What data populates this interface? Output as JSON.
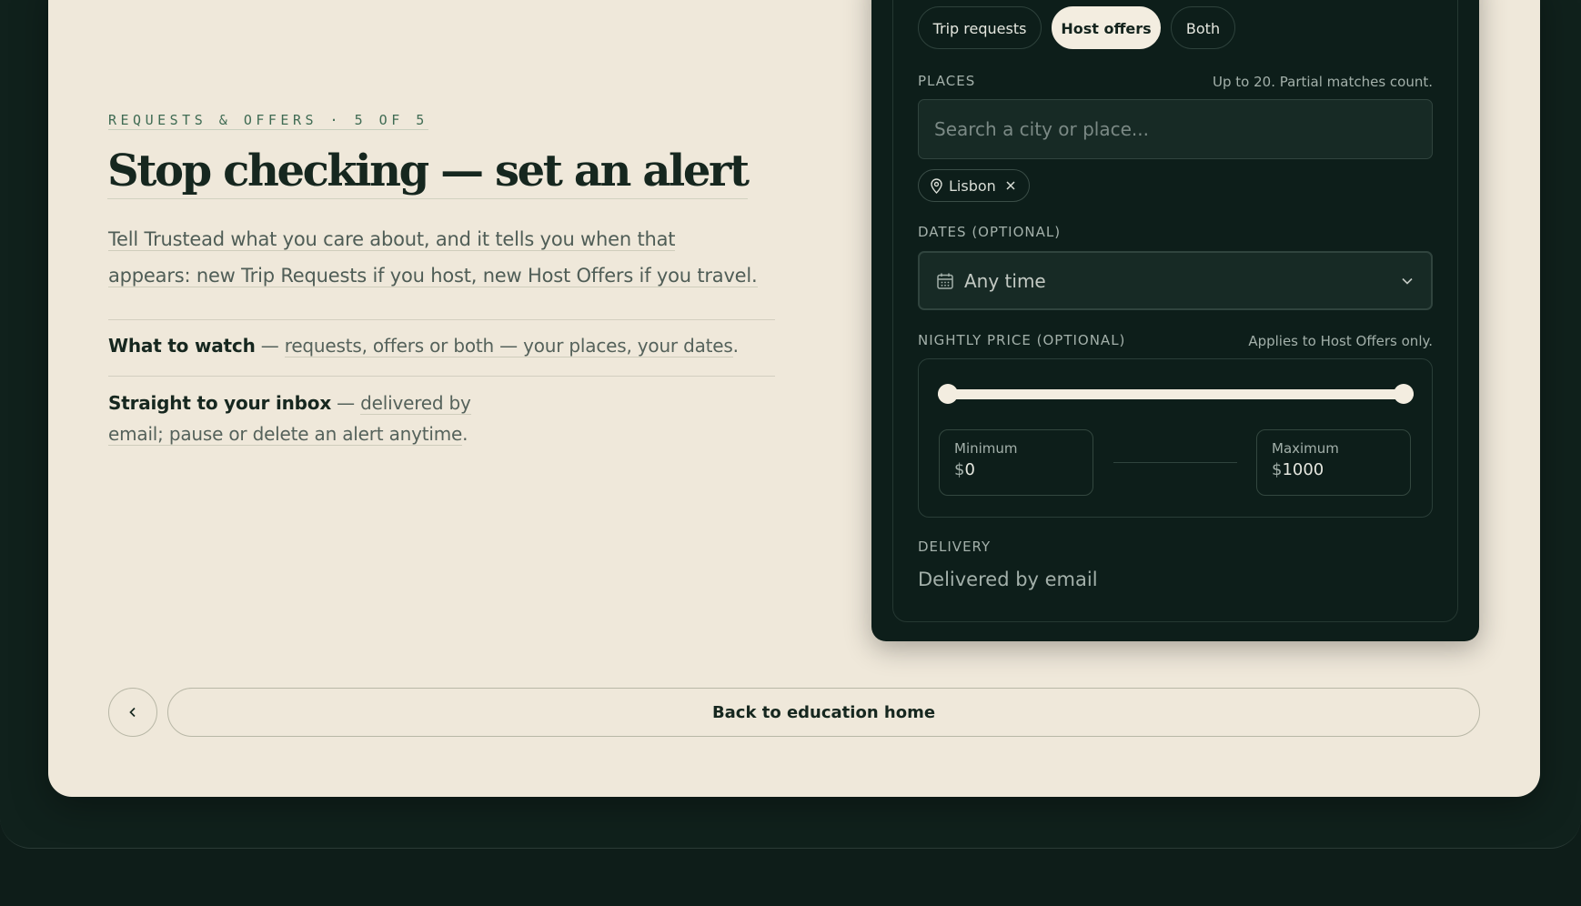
{
  "intro": {
    "eyebrow": "REQUESTS & OFFERS · 5 OF 5",
    "title": "Stop checking — set an alert",
    "lead_line1": "Tell Trustead what you care about, and it tells you when that",
    "lead_line2": "appears: new Trip Requests if you host, new Host Offers if you travel."
  },
  "features": [
    {
      "title": "What to watch",
      "dash": " — ",
      "text": "requests, offers or both — your places, your dates",
      "end": "."
    },
    {
      "title": "Straight to your inbox",
      "dash": " — ",
      "text_line1": "delivered by",
      "text_line2": "email; pause or delete an alert anytime",
      "end": "."
    }
  ],
  "alert_form": {
    "tabs": [
      {
        "label": "Trip requests",
        "active": false
      },
      {
        "label": "Host offers",
        "active": true
      },
      {
        "label": "Both",
        "active": false
      }
    ],
    "places": {
      "label": "PLACES",
      "hint": "Up to 20. Partial matches count.",
      "placeholder": "Search a city or place...",
      "value": "",
      "chips": [
        "Lisbon"
      ]
    },
    "dates": {
      "label": "DATES (OPTIONAL)",
      "value": "Any time"
    },
    "price": {
      "label": "NIGHTLY PRICE (OPTIONAL)",
      "hint": "Applies to Host Offers only.",
      "min_label": "Minimum",
      "max_label": "Maximum",
      "currency": "$",
      "min_value": "0",
      "max_value": "1000",
      "range_low": 0,
      "range_high": 1000
    },
    "delivery": {
      "label": "DELIVERY",
      "value": "Delivered by email"
    }
  },
  "nav": {
    "home_label": "Back to education home"
  },
  "colors": {
    "page_bg": "#efe8da",
    "panel_bg": "#0d1e1a",
    "accent_light": "#f3ede0",
    "eyebrow": "#3f6b53"
  }
}
